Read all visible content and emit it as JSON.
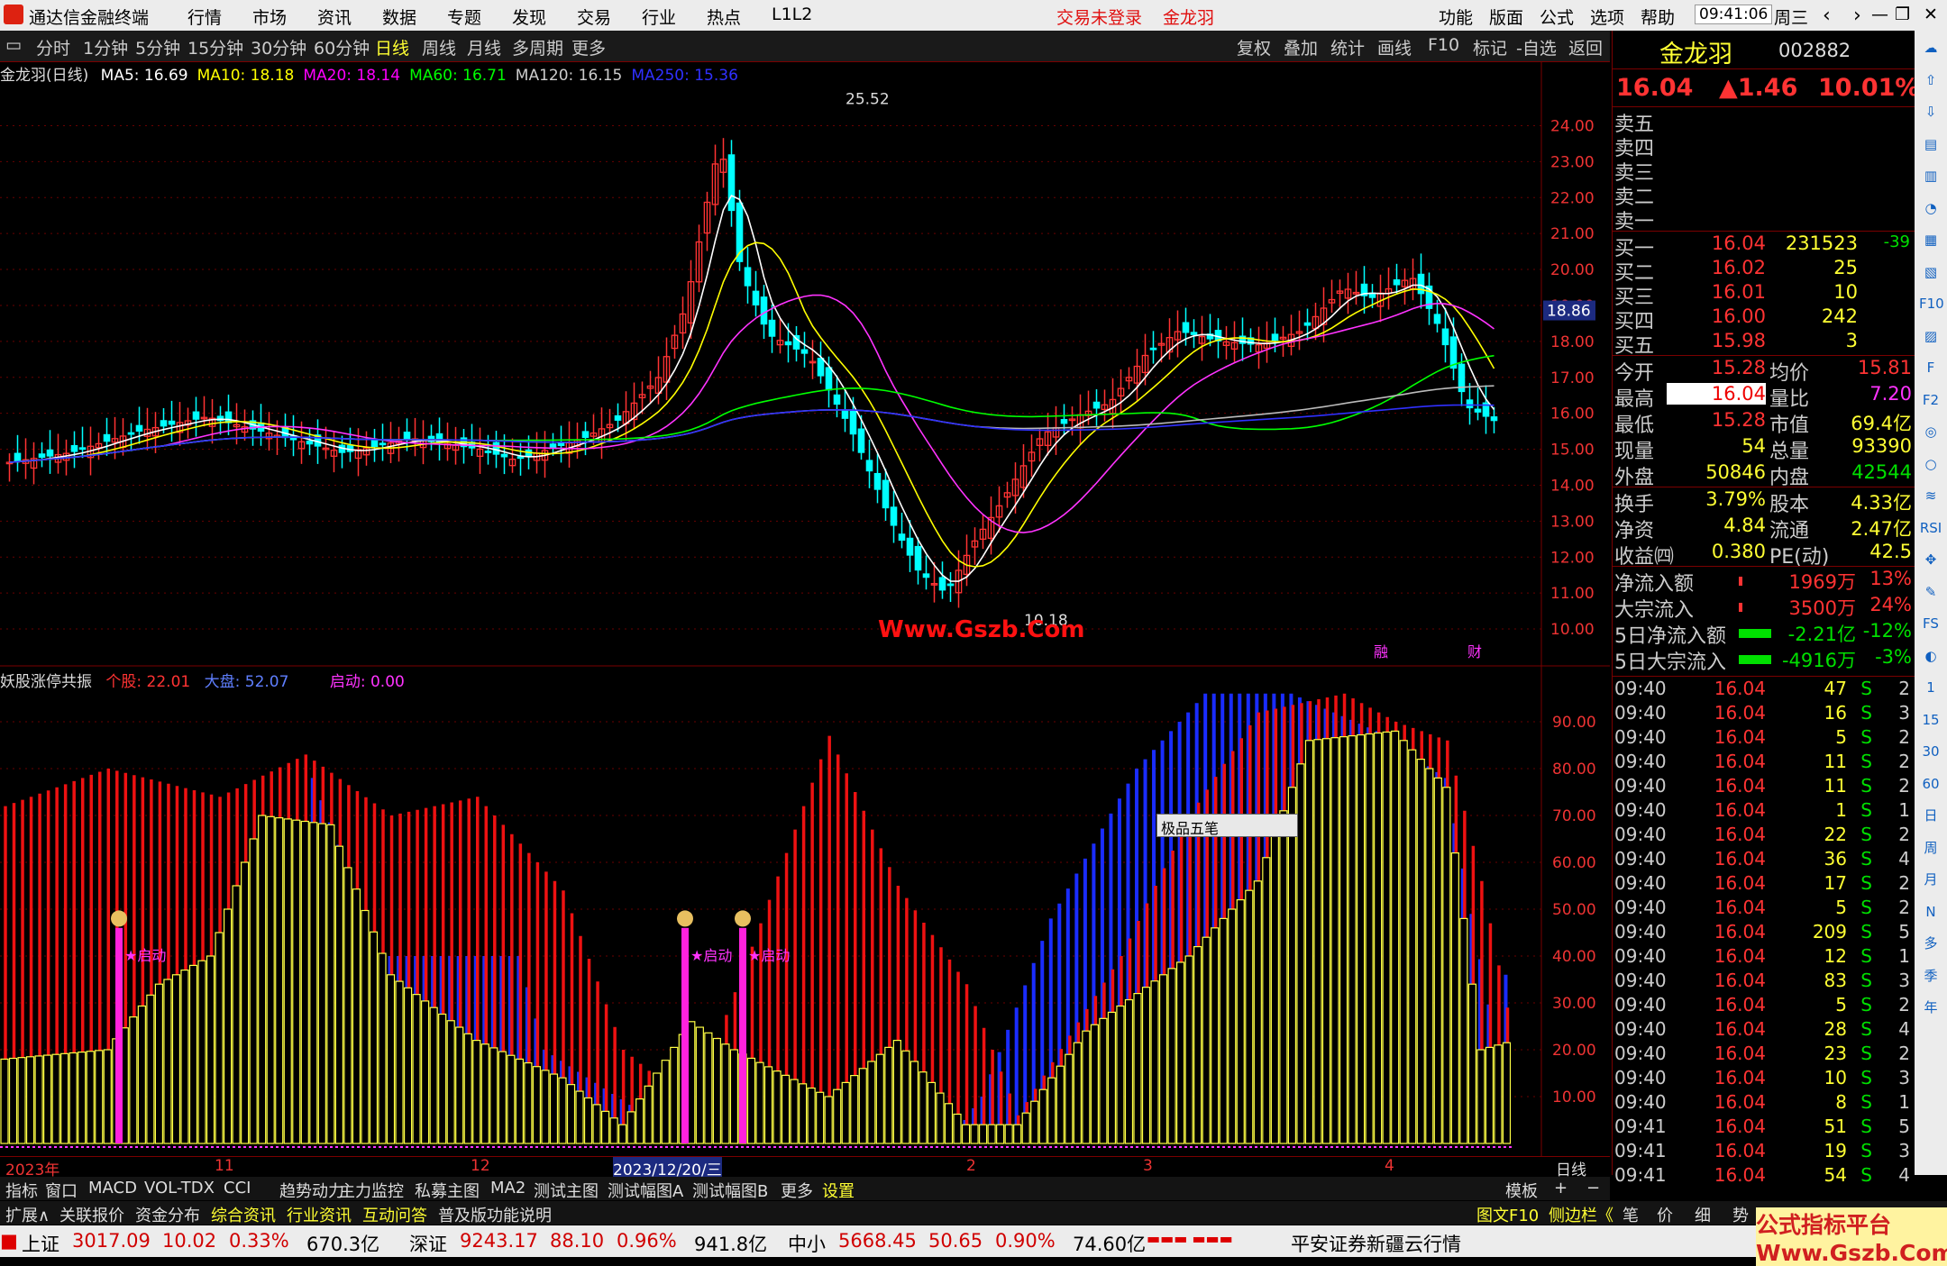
{
  "titlebar": {
    "app_title": "通达信金融终端",
    "menu": [
      "行情",
      "市场",
      "资讯",
      "数据",
      "专题",
      "发现",
      "交易",
      "行业",
      "热点",
      "L1L2"
    ],
    "login_status": "交易未登录",
    "stock_name": "金龙羽",
    "right_menu": [
      "功能",
      "版面",
      "公式",
      "选项",
      "帮助"
    ],
    "time": "09:41:06",
    "weekday": "周三"
  },
  "toolbar": {
    "periods": [
      "分时",
      "1分钟",
      "5分钟",
      "15分钟",
      "30分钟",
      "60分钟",
      "日线",
      "周线",
      "月线",
      "多周期",
      "更多"
    ],
    "selected": "日线",
    "tools": [
      "复权",
      "叠加",
      "统计",
      "画线",
      "F10",
      "标记",
      "-自选",
      "返回"
    ]
  },
  "main_chart": {
    "label": "金龙羽(日线)",
    "ma": [
      {
        "name": "MA5: 16.69",
        "color": "#ffffff"
      },
      {
        "name": "MA10: 18.18",
        "color": "#ffff00"
      },
      {
        "name": "MA20: 18.14",
        "color": "#ff00ff"
      },
      {
        "name": "MA60: 16.71",
        "color": "#00ff00"
      },
      {
        "name": "MA120: 16.15",
        "color": "#cccccc"
      },
      {
        "name": "MA250: 15.36",
        "color": "#3030ff"
      }
    ],
    "high_label": "25.52",
    "low_label": "10.18",
    "current_price_tag": "18.86",
    "y_ticks": [
      "24.00",
      "23.00",
      "22.00",
      "21.00",
      "20.00",
      "19.00",
      "18.00",
      "17.00",
      "16.00",
      "15.00",
      "14.00",
      "13.00",
      "12.00",
      "11.00",
      "10.00"
    ],
    "badge1": "融",
    "badge2": "财"
  },
  "watermark": "Www.Gszb.Com",
  "sub_chart": {
    "name": "妖股涨停共振",
    "stock_value": "个股: 22.01",
    "market_value": "大盘: 52.07",
    "start_value": "启动: 0.00",
    "y_ticks": [
      "90.00",
      "80.00",
      "70.00",
      "60.00",
      "50.00",
      "40.00",
      "30.00",
      "20.00",
      "10.00"
    ],
    "signal_label": "★启动"
  },
  "popup": {
    "label": "极品五笔"
  },
  "x_axis": {
    "labels": [
      "2023年",
      "11",
      "12",
      "2023/12/20/三",
      "2",
      "3",
      "4"
    ],
    "period": "日线"
  },
  "bottom_tabs1": [
    "指标",
    "窗口",
    "MACD",
    "VOL-TDX",
    "CCI",
    "趋势动力",
    "主力监控",
    "私募主图",
    "MA2",
    "测试主图",
    "测试幅图A",
    "测试幅图B",
    "更多",
    "设置"
  ],
  "bottom_tabs1_right": "模板",
  "bottom_tabs2": [
    "扩展∧",
    "关联报价",
    "资金分布",
    "综合资讯",
    "行业资讯",
    "互动问答",
    "普及版功能说明"
  ],
  "bottom_tabs2_right": [
    "图文F10",
    "侧边栏《",
    "笔",
    "价",
    "细",
    "势"
  ],
  "right_panel": {
    "name": "金龙羽",
    "code": "002882",
    "price": "16.04",
    "change": "▲1.46",
    "change_pct": "10.01%",
    "sells": [
      "卖五",
      "卖四",
      "卖三",
      "卖二",
      "卖一"
    ],
    "buys": [
      {
        "label": "买一",
        "price": "16.04",
        "vol": "231523",
        "delta": "-39"
      },
      {
        "label": "买二",
        "price": "16.02",
        "vol": "25",
        "delta": ""
      },
      {
        "label": "买三",
        "price": "16.01",
        "vol": "10",
        "delta": ""
      },
      {
        "label": "买四",
        "price": "16.00",
        "vol": "242",
        "delta": ""
      },
      {
        "label": "买五",
        "price": "15.98",
        "vol": "3",
        "delta": ""
      }
    ],
    "stats": [
      {
        "l1": "今开",
        "v1": "15.28",
        "l2": "均价",
        "v2": "15.81"
      },
      {
        "l1": "最高",
        "v1": "16.04",
        "l2": "量比",
        "v2": "7.20"
      },
      {
        "l1": "最低",
        "v1": "15.28",
        "l2": "市值",
        "v2": "69.4亿"
      },
      {
        "l1": "现量",
        "v1": "54",
        "l2": "总量",
        "v2": "93390"
      },
      {
        "l1": "外盘",
        "v1": "50846",
        "l2": "内盘",
        "v2": "42544"
      }
    ],
    "stats2": [
      {
        "l1": "换手",
        "v1": "3.79%",
        "l2": "股本",
        "v2": "4.33亿"
      },
      {
        "l1": "净资",
        "v1": "4.84",
        "l2": "流通",
        "v2": "2.47亿"
      },
      {
        "l1": "收益㈣",
        "v1": "0.380",
        "l2": "PE(动)",
        "v2": "42.5"
      }
    ],
    "flows": [
      {
        "l": "净流入额",
        "v": "1969万",
        "p": "13%",
        "c": "#ff3333"
      },
      {
        "l": "大宗流入",
        "v": "3500万",
        "p": "24%",
        "c": "#ff3333"
      },
      {
        "l": "5日净流入额",
        "v": "-2.21亿",
        "p": "-12%",
        "c": "#00e000"
      },
      {
        "l": "5日大宗流入",
        "v": "-4916万",
        "p": "-3%",
        "c": "#00e000"
      }
    ],
    "ticks": [
      [
        "09:40",
        "16.04",
        "47",
        "S",
        "2"
      ],
      [
        "09:40",
        "16.04",
        "16",
        "S",
        "3"
      ],
      [
        "09:40",
        "16.04",
        "5",
        "S",
        "2"
      ],
      [
        "09:40",
        "16.04",
        "11",
        "S",
        "2"
      ],
      [
        "09:40",
        "16.04",
        "11",
        "S",
        "2"
      ],
      [
        "09:40",
        "16.04",
        "1",
        "S",
        "1"
      ],
      [
        "09:40",
        "16.04",
        "22",
        "S",
        "2"
      ],
      [
        "09:40",
        "16.04",
        "36",
        "S",
        "4"
      ],
      [
        "09:40",
        "16.04",
        "17",
        "S",
        "2"
      ],
      [
        "09:40",
        "16.04",
        "5",
        "S",
        "2"
      ],
      [
        "09:40",
        "16.04",
        "209",
        "S",
        "5"
      ],
      [
        "09:40",
        "16.04",
        "12",
        "S",
        "1"
      ],
      [
        "09:40",
        "16.04",
        "83",
        "S",
        "3"
      ],
      [
        "09:40",
        "16.04",
        "5",
        "S",
        "2"
      ],
      [
        "09:40",
        "16.04",
        "28",
        "S",
        "4"
      ],
      [
        "09:40",
        "16.04",
        "23",
        "S",
        "2"
      ],
      [
        "09:40",
        "16.04",
        "10",
        "S",
        "3"
      ],
      [
        "09:40",
        "16.04",
        "8",
        "S",
        "1"
      ],
      [
        "09:41",
        "16.04",
        "51",
        "S",
        "5"
      ],
      [
        "09:41",
        "16.04",
        "19",
        "S",
        "3"
      ],
      [
        "09:41",
        "16.04",
        "54",
        "S",
        "4"
      ]
    ]
  },
  "iconstrip": [
    "☁",
    "⇧",
    "⇩",
    "▤",
    "▥",
    "◔",
    "▦",
    "▧",
    "F10",
    "▨",
    "F",
    "F2",
    "◎",
    "○",
    "≋",
    "RSI",
    "✥",
    "✎",
    "FS",
    "◐",
    "1",
    "15",
    "30",
    "60",
    "日",
    "周",
    "月",
    "N",
    "多",
    "季",
    "年"
  ],
  "statusbar": {
    "items": [
      {
        "name": "上证",
        "v": "3017.09",
        "c": "10.02",
        "p": "0.33%",
        "a": "670.3亿"
      },
      {
        "name": "深证",
        "v": "9243.17",
        "c": "88.10",
        "p": "0.96%",
        "a": "941.8亿"
      },
      {
        "name": "中小",
        "v": "5668.45",
        "c": "50.65",
        "p": "0.90%",
        "a": "74.60亿"
      }
    ],
    "broker": "平安证券新疆云行情",
    "brand": "公式指标平台 Www.Gszb.Com"
  }
}
